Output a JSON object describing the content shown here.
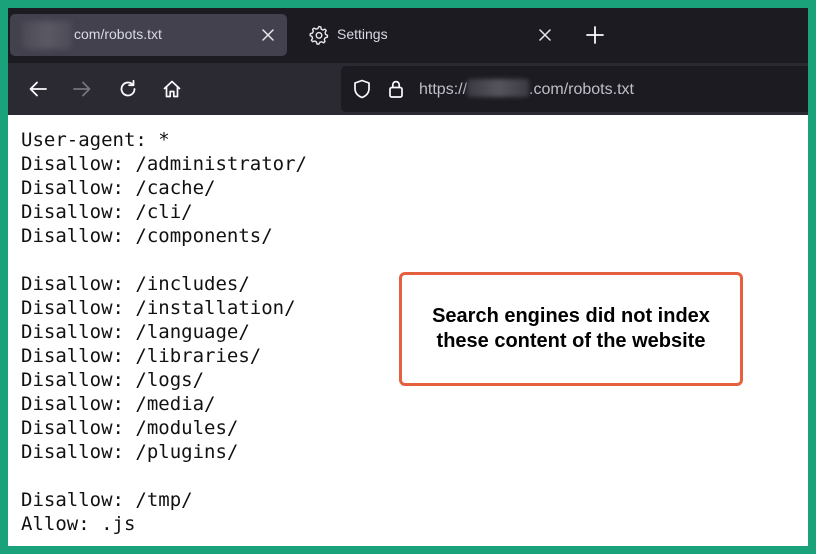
{
  "browser": {
    "tabs": [
      {
        "title": "com/robots.txt",
        "active": true
      },
      {
        "title": "Settings",
        "active": false
      }
    ],
    "url": {
      "prefix": "https://",
      "suffix": ".com/robots.txt"
    }
  },
  "robots_lines": [
    "User-agent: *",
    "Disallow: /administrator/",
    "Disallow: /cache/",
    "Disallow: /cli/",
    "Disallow: /components/",
    "",
    "Disallow: /includes/",
    "Disallow: /installation/",
    "Disallow: /language/",
    "Disallow: /libraries/",
    "Disallow: /logs/",
    "Disallow: /media/",
    "Disallow: /modules/",
    "Disallow: /plugins/",
    "",
    "Disallow: /tmp/",
    "Allow: .js"
  ],
  "callout": {
    "text": "Search engines did not index these content of the website"
  },
  "colors": {
    "frame_border": "#1aa27a",
    "callout_border": "#e5603e",
    "tabbar_bg": "#1c1b22",
    "toolbar_bg": "#2b2a33",
    "active_tab_bg": "#42414d"
  },
  "icons": {
    "tab_close": "close-icon",
    "settings": "gear-icon",
    "new_tab": "plus-icon",
    "back": "back-arrow-icon",
    "forward": "forward-arrow-icon",
    "reload": "reload-icon",
    "home": "home-icon",
    "shield": "shield-icon",
    "lock": "lock-icon"
  }
}
